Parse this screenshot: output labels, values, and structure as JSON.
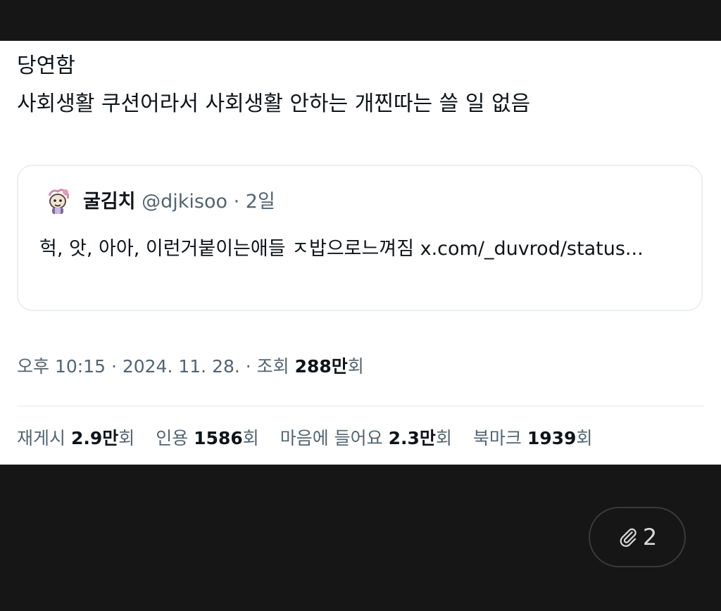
{
  "post": {
    "line1": "당연함",
    "line2": "사회생활 쿠션어라서 사회생활 안하는  개찐따는 쓸 일 없음"
  },
  "quote": {
    "display_name": "굴김치",
    "handle": "@djkisoo",
    "separator": " · ",
    "time": "2일",
    "text": "헉, 앗, 아아, 이런거붙이는애들 ㅈ밥으로느껴짐 x.com/_duvrod/status..."
  },
  "meta": {
    "time": "오후 10:15",
    "sep1": " · ",
    "date": "2024. 11. 28.",
    "sep2": " · ",
    "views_label": "조회 ",
    "views_value": "288만",
    "views_suffix": "회"
  },
  "stats": {
    "reposts": {
      "label": "재게시 ",
      "value": "2.9만",
      "suffix": "회"
    },
    "quotes": {
      "label": "인용 ",
      "value": "1586",
      "suffix": "회"
    },
    "likes": {
      "label": "마음에 들어요 ",
      "value": "2.3만",
      "suffix": "회"
    },
    "bookmarks": {
      "label": "북마크 ",
      "value": "1939",
      "suffix": "회"
    }
  },
  "attachments": {
    "icon": "paperclip-icon",
    "count": "2"
  },
  "colors": {
    "text_primary": "#0f1419",
    "text_secondary": "#536471",
    "frame_background": "#161616"
  }
}
